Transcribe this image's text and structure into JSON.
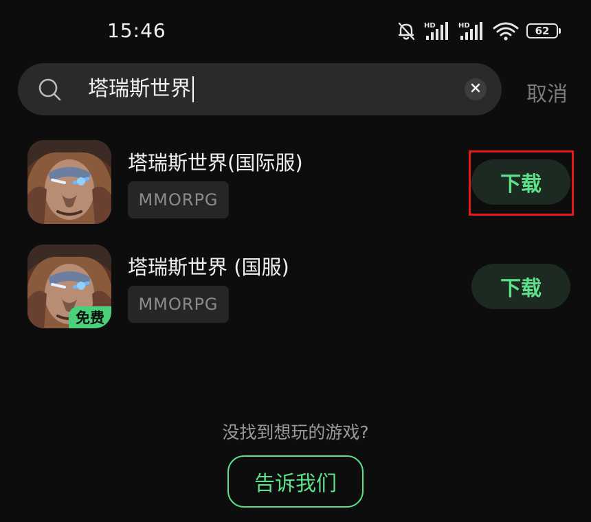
{
  "status_bar": {
    "time": "15:46",
    "icons": [
      "mute-bell-icon",
      "signal-hd-icon",
      "signal-hd-icon",
      "wifi-icon"
    ],
    "battery": "62"
  },
  "search": {
    "query": "塔瑞斯世界",
    "cancel_label": "取消"
  },
  "results": [
    {
      "title": "塔瑞斯世界(国际服)",
      "genre": "MMORPG",
      "download_label": "下载",
      "badge": ""
    },
    {
      "title": "塔瑞斯世界 (国服)",
      "genre": "MMORPG",
      "download_label": "下载",
      "badge": "免费"
    }
  ],
  "footer": {
    "prompt": "没找到想玩的游戏?",
    "tell_us_label": "告诉我们"
  },
  "colors": {
    "background": "#0d0d0d",
    "accent_green": "#5ee08a",
    "highlight_red": "#e61919"
  }
}
